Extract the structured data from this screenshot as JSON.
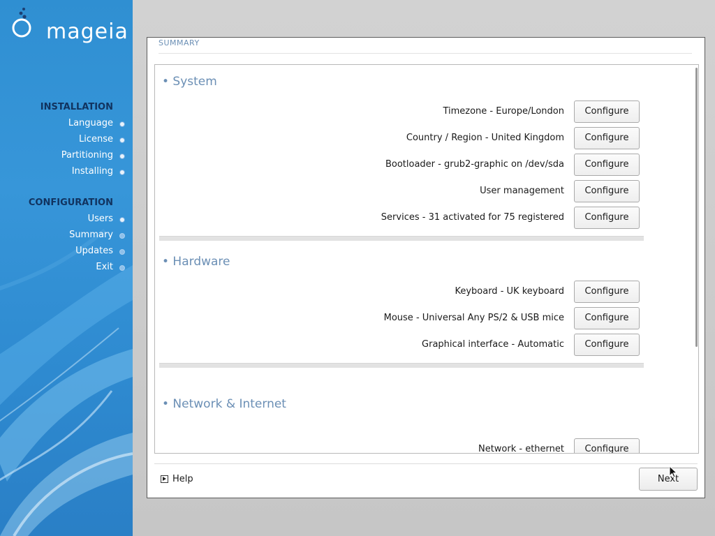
{
  "brand": {
    "logo_text": "mageia"
  },
  "sidebar": {
    "groups": [
      {
        "heading": "INSTALLATION",
        "items": [
          {
            "label": "Language"
          },
          {
            "label": "License"
          },
          {
            "label": "Partitioning"
          },
          {
            "label": "Installing"
          }
        ]
      },
      {
        "heading": "CONFIGURATION",
        "items": [
          {
            "label": "Users"
          },
          {
            "label": "Summary"
          },
          {
            "label": "Updates"
          },
          {
            "label": "Exit"
          }
        ]
      }
    ]
  },
  "dialog": {
    "title": "SUMMARY",
    "sections": [
      {
        "title": "• System",
        "rows": [
          {
            "label": "Timezone - Europe/London",
            "button": "Configure"
          },
          {
            "label": "Country / Region - United Kingdom",
            "button": "Configure"
          },
          {
            "label": "Bootloader - grub2-graphic on /dev/sda",
            "button": "Configure"
          },
          {
            "label": "User management",
            "button": "Configure"
          },
          {
            "label": "Services - 31 activated for 75 registered",
            "button": "Configure"
          }
        ]
      },
      {
        "title": "• Hardware",
        "rows": [
          {
            "label": "Keyboard - UK keyboard",
            "button": "Configure"
          },
          {
            "label": "Mouse - Universal Any PS/2 & USB mice",
            "button": "Configure"
          },
          {
            "label": "Graphical interface - Automatic",
            "button": "Configure"
          }
        ]
      },
      {
        "title": "• Network & Internet",
        "rows": [
          {
            "label": "Network - ethernet",
            "button": "Configure"
          }
        ]
      }
    ],
    "help_label": "Help",
    "next_label": "Next"
  }
}
